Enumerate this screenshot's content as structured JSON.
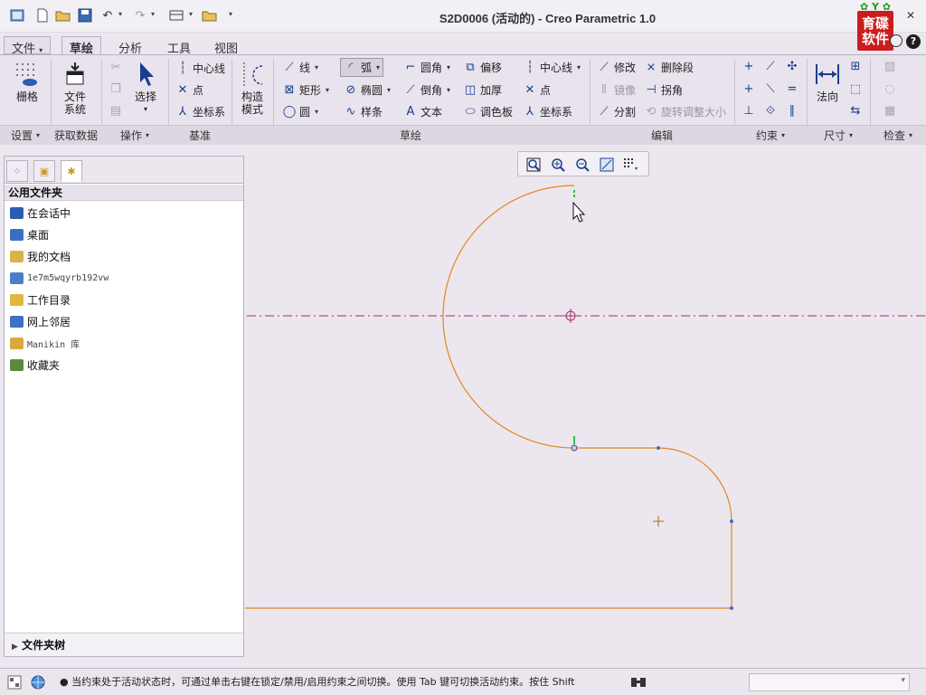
{
  "app": {
    "title": "S2D0006 (活动的) - Creo Parametric 1.0",
    "logo_text": [
      "育碟",
      "软件"
    ],
    "help_label": "?"
  },
  "tabs": [
    {
      "label": "文件",
      "arrow": "▾"
    },
    {
      "label": "草绘",
      "active": true
    },
    {
      "label": "分析"
    },
    {
      "label": "工具"
    },
    {
      "label": "视图"
    }
  ],
  "ribbon": {
    "settings": {
      "grid_label": "栅格"
    },
    "data": {
      "file_system_label": [
        "文件",
        "系统"
      ]
    },
    "operations": {
      "select_label": "选择"
    },
    "datum": {
      "centerline": "中心线",
      "point": "点",
      "coord": "坐标系"
    },
    "construct": {
      "label": [
        "构造",
        "模式"
      ]
    },
    "sketch": {
      "line": "线",
      "arc": "弧",
      "fillet": "圆角",
      "offset": "偏移",
      "rectangle": "矩形",
      "ellipse": "椭圆",
      "chamfer": "倒角",
      "thicken": "加厚",
      "circle": "圆",
      "spline": "样条",
      "text": "文本",
      "palette": "调色板",
      "centerline2": "中心线",
      "point2": "点",
      "coord2": "坐标系"
    },
    "edit": {
      "modify": "修改",
      "delete_segment": "删除段",
      "mirror": "镜像",
      "corner": "拐角",
      "divide": "分割",
      "rotate_resize": "旋转调整大小"
    },
    "dimension": {
      "normal": "法向"
    },
    "groups": [
      {
        "label": "设置",
        "arrow": "▾"
      },
      {
        "label": "获取数据",
        "arrow": ""
      },
      {
        "label": "操作",
        "arrow": "▾"
      },
      {
        "label": "基准",
        "arrow": ""
      },
      {
        "label": "草绘",
        "arrow": ""
      },
      {
        "label": "编辑",
        "arrow": ""
      },
      {
        "label": "约束",
        "arrow": "▾"
      },
      {
        "label": "尺寸",
        "arrow": "▾"
      },
      {
        "label": "检查",
        "arrow": "▾"
      }
    ]
  },
  "left_panel": {
    "header": "公用文件夹",
    "items": [
      {
        "label": "在会话中",
        "icon": "session-icon",
        "color": "#2a5db0"
      },
      {
        "label": "桌面",
        "icon": "desktop-icon",
        "color": "#3b6fc4"
      },
      {
        "label": "我的文档",
        "icon": "my-documents-icon",
        "color": "#d9b24a"
      },
      {
        "label": "1e7m5wqyrb192vw",
        "icon": "computer-icon",
        "color": "#4a7fc8",
        "mono": true
      },
      {
        "label": "工作目录",
        "icon": "working-directory-icon",
        "color": "#e2b740"
      },
      {
        "label": "网上邻居",
        "icon": "network-icon",
        "color": "#3b72c2"
      },
      {
        "label": "Manikin 库",
        "icon": "library-icon",
        "color": "#d9a93e",
        "mono": true
      },
      {
        "label": "收藏夹",
        "icon": "favorites-icon",
        "color": "#5b8a3c"
      }
    ],
    "footer": "文件夹树"
  },
  "status": {
    "message": "● 当约束处于活动状态时，可通过单击右键在锁定/禁用/启用约束之间切换。使用 Tab 键可切换活动约束。按住 Shift"
  },
  "colors": {
    "sketch_geometry": "#e08a1a",
    "centerline": "#a0306a",
    "constraint": "#2fc14a"
  }
}
